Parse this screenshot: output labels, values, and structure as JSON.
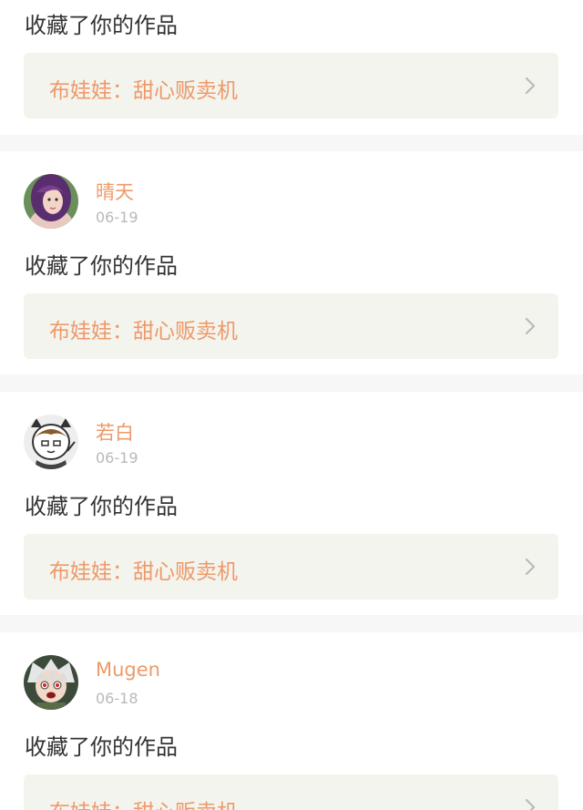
{
  "items": [
    {
      "action": "收藏了你的作品",
      "work_title": "布娃娃：甜心贩卖机"
    },
    {
      "username": "晴天",
      "date": "06-19",
      "action": "收藏了你的作品",
      "work_title": "布娃娃：甜心贩卖机",
      "avatar_icon": "avatar-girl"
    },
    {
      "username": "若白",
      "date": "06-19",
      "action": "收藏了你的作品",
      "work_title": "布娃娃：甜心贩卖机",
      "avatar_icon": "avatar-cartoon-boy"
    },
    {
      "username": "Mugen",
      "date": "06-18",
      "action": "收藏了你的作品",
      "work_title": "布娃娃：甜心贩卖机",
      "avatar_icon": "avatar-anime"
    }
  ],
  "colors": {
    "accent": "#ed9a6a",
    "date": "#b9b9b9",
    "text": "#333333",
    "link_bg": "#f4f4ee",
    "separator": "#f7f7f7"
  }
}
